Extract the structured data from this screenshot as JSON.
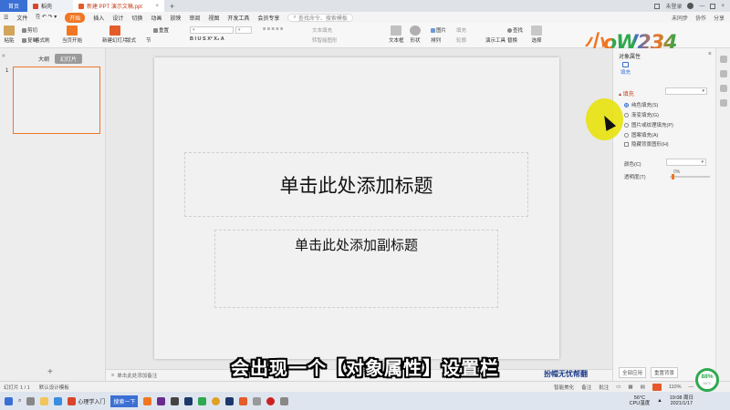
{
  "tabs": {
    "home": "首页",
    "doc": "稻壳",
    "active": "新建 PPT 演示文稿.ppt",
    "right_label": "未登录"
  },
  "menu": {
    "file": "文件",
    "start": "开始",
    "items": [
      "插入",
      "设计",
      "切换",
      "动画",
      "放映",
      "审阅",
      "视图",
      "开发工具",
      "会员专享"
    ],
    "search": "查找命令、搜索模板",
    "right": [
      "未同步",
      "协作",
      "分享"
    ]
  },
  "ribbon": {
    "paste": "粘贴",
    "cut": "剪切",
    "copy": "复制",
    "format_painter": "格式刷",
    "from_start": "当页开始",
    "new_slide": "新建幻灯片",
    "layout": "版式",
    "section": "节",
    "reset": "重置",
    "textbox": "文本框",
    "shape": "形状",
    "arrange": "排列",
    "picture": "图片",
    "fill": "填充",
    "outline": "轮廓",
    "presentation_tools": "演示工具",
    "find": "查找",
    "replace": "替换",
    "select": "选择",
    "convert_to_smartart": "转智能图形",
    "text_fill": "文本填充"
  },
  "logo": {
    "text": "小oW234",
    "colors": {
      "a": "#f07623",
      "b": "#2fa84f",
      "c": "#3a6fd4"
    }
  },
  "left_panel": {
    "outline_tab": "大纲",
    "slides_tab": "幻灯片",
    "slide_number": "1",
    "add_symbol": "+"
  },
  "slide": {
    "title_placeholder": "单击此处添加标题",
    "subtitle_placeholder": "单击此处添加副标题"
  },
  "notes": {
    "placeholder": "单击此处添加备注"
  },
  "properties": {
    "header": "对象属性",
    "tab_fill": "填充",
    "section_fill": "填充",
    "options": [
      "纯色填充(S)",
      "渐变填充(G)",
      "图片或纹理填充(P)",
      "图案填充(A)"
    ],
    "hide_bg": "隐藏背景图形(H)",
    "color_label": "颜色(C)",
    "transparency_label": "透明度(T)",
    "transparency_value": "0%",
    "transparency_fraction": 0,
    "apply_all": "全部应用",
    "reset_bg": "重置背景"
  },
  "status": {
    "slide_info": "幻灯片 1 / 1",
    "template": "默认设计模板",
    "smart_beautify": "智能美化",
    "notes": "备注",
    "comments": "批注",
    "zoom": "110%"
  },
  "caption": "会出现一个【对象属性】设置栏",
  "watermark": "扮帽无忧帮翻",
  "taskbar": {
    "app1": "心理学入门",
    "search_btn": "搜索一下",
    "temp": "56°C",
    "cpu": "CPU温度",
    "time": "19:08 周日",
    "date": "2021/1/17"
  },
  "meter": {
    "percent": "88%",
    "temp": "54°C"
  }
}
